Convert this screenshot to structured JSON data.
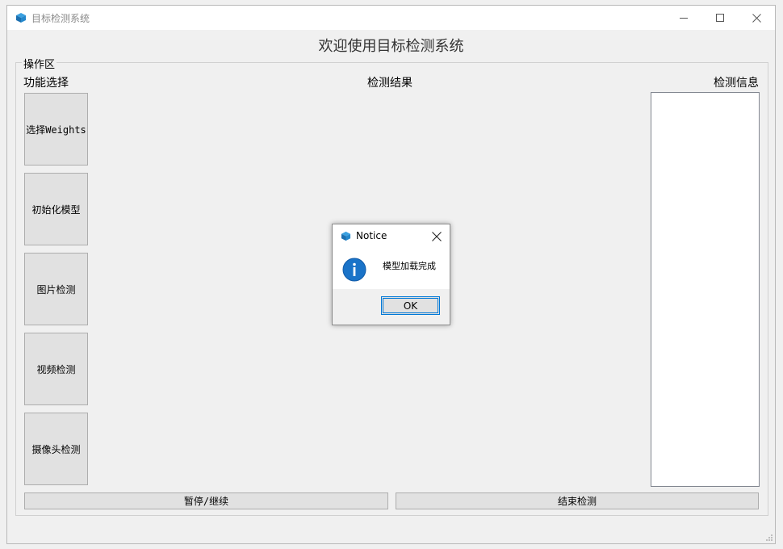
{
  "window": {
    "title": "目标检测系统",
    "icon": "cube-icon",
    "controls": {
      "minimize": "minimize-icon",
      "maximize": "maximize-icon",
      "close": "close-icon"
    }
  },
  "header": {
    "title": "欢迎使用目标检测系统"
  },
  "group": {
    "label": "操作区"
  },
  "sections": {
    "functions": "功能选择",
    "results": "检测结果",
    "info": "检测信息"
  },
  "side_buttons": [
    {
      "label": "选择Weights"
    },
    {
      "label": "初始化模型"
    },
    {
      "label": "图片检测"
    },
    {
      "label": "视频检测"
    },
    {
      "label": "摄像头检测"
    }
  ],
  "bottom_buttons": {
    "pause": "暂停/继续",
    "end": "结束检测"
  },
  "dialog": {
    "title": "Notice",
    "message": "模型加载完成",
    "ok_label": "OK",
    "icon": "info-icon"
  },
  "colors": {
    "accent": "#0078d7",
    "info_icon": "#1a73c8",
    "background": "#f0f0f0"
  }
}
